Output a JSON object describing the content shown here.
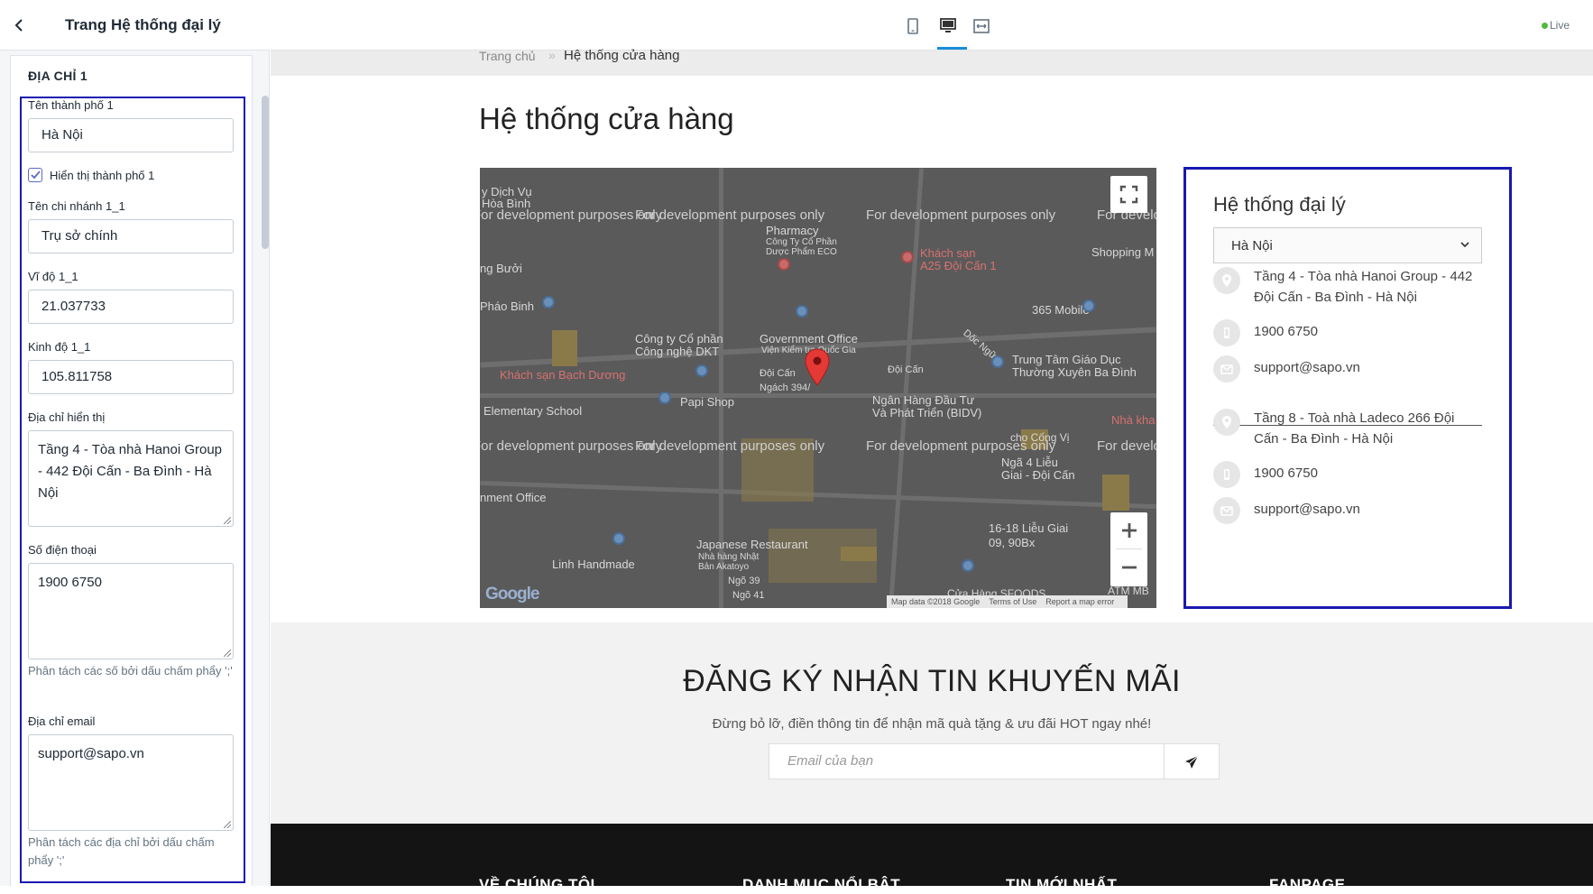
{
  "sidebar": {
    "title": "Trang Hệ thống đại lý",
    "section_title": "ĐỊA CHỈ 1",
    "fields": {
      "city_label": "Tên thành phố 1",
      "city_value": "Hà Nội",
      "show_city_label": "Hiển thị thành phố 1",
      "branch_label": "Tên chi nhánh 1_1",
      "branch_value": "Trụ sở chính",
      "lat_label": "Vĩ độ 1_1",
      "lat_value": "21.037733",
      "lng_label": "Kinh độ 1_1",
      "lng_value": "105.811758",
      "address_label": "Địa chỉ hiển thị",
      "address_value": "Tầng 4 - Tòa nhà Hanoi Group - 442  Đội Cấn - Ba Đình - Hà Nội",
      "phone_label": "Số điện thoại",
      "phone_value": "1900 6750",
      "phone_help": "Phân tách các số bởi dấu chấm phẩy ';'",
      "email_label": "Địa chỉ email",
      "email_value": "support@sapo.vn",
      "email_help": "Phân tách các địa chỉ bởi dấu chấm phẩy ';'"
    }
  },
  "topbar": {
    "live_label": "Live"
  },
  "breadcrumb": {
    "home": "Trang chủ",
    "separator": "»",
    "current": "Hệ thống cửa hàng"
  },
  "page_title": "Hệ thống cửa hàng",
  "map": {
    "dev_text": "For development purposes only",
    "labels": {
      "hoa_binh": "y Dịch Vụ\nHòa Bình",
      "pharmacy": "Pharmacy",
      "pharmacy_sub": "Công Ty Cổ Phần\nDược Phẩm ECO",
      "khach_san_a25": "Khách sạn\nA25 Đội Cấn 1",
      "shopping": "Shopping M",
      "ong_buoi": "ng Bưởi",
      "phao_binh": "Pháo Binh",
      "mobile365": "365 Mobile",
      "cong_ty_dkt": "Công ty Cổ phần\nCông nghệ DKT",
      "gov_office": "Government Office",
      "gov_office_sub": "Viện Kiểm tra Quốc Gia",
      "doi_can_a": "Đội Cấn",
      "doi_can_b": "Đội Cấn",
      "doc_ngu": "Dốc Ngữ",
      "trung_tam": "Trung Tâm Giáo Dục\nThường Xuyên Ba Đình",
      "ks_bach_duong": "Khách sạn Bạch Dương",
      "papi_shop": "Papi Shop",
      "ngach": "Ngách 394/",
      "ngan_hang": "Ngân Hàng Đầu Tư\nVà Phát Triển (BIDV)",
      "elementary": "Elementary School",
      "nha_kha": "Nhà kha",
      "cong_vi": "cho Cống Vị",
      "nga4": "Ngã 4 Liễu\nGiai - Đội Cấn",
      "nment_office": "nment Office",
      "lieu_giai": "16-18 Liễu Giai\n09, 90Bx",
      "japanese": "Japanese Restaurant",
      "japanese_sub": "Nhà hàng Nhật\nBản Akatoyo",
      "linh_handmade": "Linh Handmade",
      "ngo39": "Ngõ 39",
      "ngo41": "Ngõ 41",
      "sfoods": "Cửa Hàng SFOODS",
      "atm": "ATM MB"
    },
    "attribution": [
      "Map data ©2018 Google",
      "Terms of Use",
      "Report a map error"
    ],
    "google": "Google"
  },
  "agency": {
    "title": "Hệ thống đại lý",
    "select_value": "Hà Nội",
    "branches": [
      {
        "address": "Tầng 4 - Tòa nhà Hanoi Group - 442 Đội Cấn - Ba Đình - Hà Nội",
        "phone": "1900 6750",
        "email": "support@sapo.vn"
      },
      {
        "address": "Tầng 8 - Toà nhà Ladeco 266 Đội Cấn - Ba Đình - Hà Nội",
        "phone": "1900 6750",
        "email": "support@sapo.vn"
      }
    ]
  },
  "newsletter": {
    "title": "ĐĂNG KÝ NHẬN TIN KHUYẾN MÃI",
    "subtitle": "Đừng bỏ lỡ, điền thông tin để nhận mã quà tặng & ưu đãi HOT ngay nhé!",
    "placeholder": "Email của bạn"
  },
  "footer": {
    "columns": [
      "VỀ CHÚNG TÔI",
      "DANH MỤC NỔI BẬT",
      "TIN MỚI NHẤT",
      "FANPAGE"
    ]
  }
}
